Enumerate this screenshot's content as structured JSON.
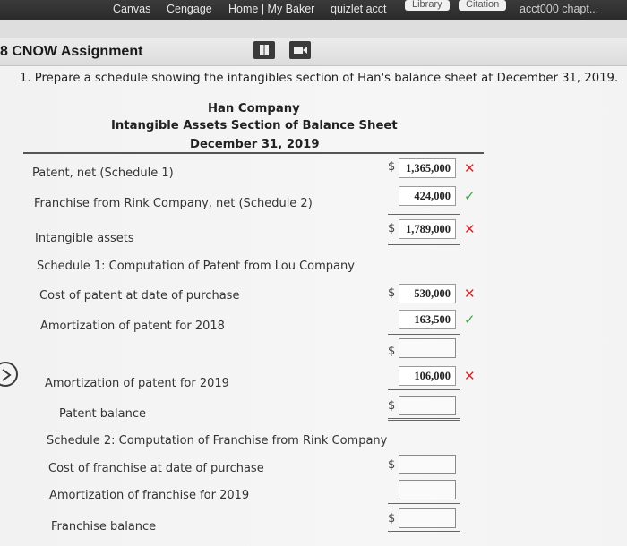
{
  "bookmarks": [
    "Canvas",
    "Cengage",
    "Home | My Baker",
    "quizlet acct",
    "Library",
    "Citation",
    "acct000 chapt..."
  ],
  "header": {
    "title": "8 CNOW Assignment",
    "icons": [
      "book-icon",
      "video-icon"
    ]
  },
  "question": "1. Prepare a schedule showing the intangibles section of Han's balance sheet at December 31, 2019.",
  "company": "Han Company",
  "section_title": "Intangible Assets Section of Balance Sheet",
  "date": "December 31, 2019",
  "rows": {
    "patent_net": {
      "label": "Patent, net (Schedule 1)",
      "currency": "$",
      "value": "1,365,000",
      "status": "incorrect"
    },
    "franchise_net": {
      "label": "Franchise from Rink Company, net (Schedule 2)",
      "value": "424,000",
      "status": "correct"
    },
    "intangible_assets": {
      "label": "Intangible assets",
      "currency": "$",
      "value": "1,789,000",
      "status": "incorrect"
    },
    "schedule1_title": "Schedule 1: Computation of Patent from Lou Company",
    "cost_patent": {
      "label": "Cost of patent at date of purchase",
      "currency": "$",
      "value": "530,000",
      "status": "incorrect"
    },
    "amort_2018": {
      "label": "Amortization of patent for 2018",
      "value": "163,500",
      "status": "correct"
    },
    "subtotal_currency": "$",
    "amort_2019": {
      "label": "Amortization of patent for 2019",
      "value": "106,000",
      "status": "incorrect"
    },
    "patent_balance": {
      "label": "Patent balance",
      "currency": "$"
    },
    "schedule2_title": "Schedule 2: Computation of Franchise from Rink Company",
    "cost_franchise": {
      "label": "Cost of franchise at date of purchase",
      "currency": "$"
    },
    "amort_franchise": {
      "label": "Amortization of franchise for 2019"
    },
    "franchise_balance": {
      "label": "Franchise balance",
      "currency": "$"
    }
  },
  "marks": {
    "incorrect": "✕",
    "correct": "✓"
  }
}
